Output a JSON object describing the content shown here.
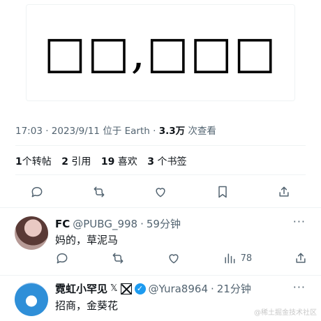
{
  "media": {
    "text": "□□,□□□"
  },
  "meta": {
    "time": "17:03",
    "date": "2023/9/11",
    "location_prefix": "位于",
    "location": "Earth",
    "views": "3.3万",
    "views_label": "次查看"
  },
  "stats": [
    {
      "num": "1",
      "label": "个转帖"
    },
    {
      "num": "2",
      "label": "引用"
    },
    {
      "num": "19",
      "label": "喜欢"
    },
    {
      "num": "3",
      "label": "个书签"
    }
  ],
  "actions": [
    "reply-icon",
    "retweet-icon",
    "like-icon",
    "bookmark-icon",
    "share-icon"
  ],
  "replies": [
    {
      "name": "FC",
      "handle": "@PUBG_998",
      "time": "59分钟",
      "text": "妈的，草泥马",
      "views": "78"
    },
    {
      "name": "霓虹小罕见",
      "badge_x": "𝕏",
      "handle": "@Yura8964",
      "time": "21分钟",
      "text": "招商，金葵花"
    }
  ],
  "watermark": "@稀土掘金技术社区",
  "colors": {
    "muted": "#536471",
    "text": "#0f1419",
    "accent": "#1d9bf0",
    "divider": "#eff3f4"
  }
}
